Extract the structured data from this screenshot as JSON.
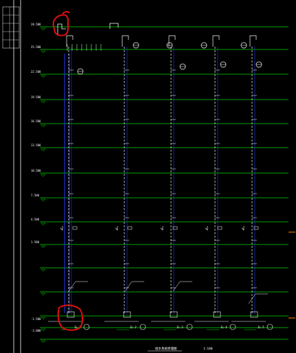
{
  "drawing": {
    "title": "给水系统原理图",
    "scale": "1:100",
    "floor_labels": [
      "28.500",
      "25.500",
      "22.500",
      "19.500",
      "16.500",
      "13.500",
      "10.500",
      "7.500",
      "4.500",
      "1.500",
      "-1.500",
      "-3.000"
    ],
    "colors": {
      "background": "#000000",
      "floor_line": "#00dd00",
      "pipe": "#1e3cff",
      "pipe_dashed": "#ffffff",
      "markup": "#e01010",
      "accent": "#ff8a00"
    },
    "markup_annotations": [
      "top-left-marked-valve",
      "bottom-left-marked-valve"
    ],
    "riser_tags": [
      "JL-1",
      "JL-2",
      "JL-3",
      "JL-4",
      "JL-5"
    ]
  }
}
